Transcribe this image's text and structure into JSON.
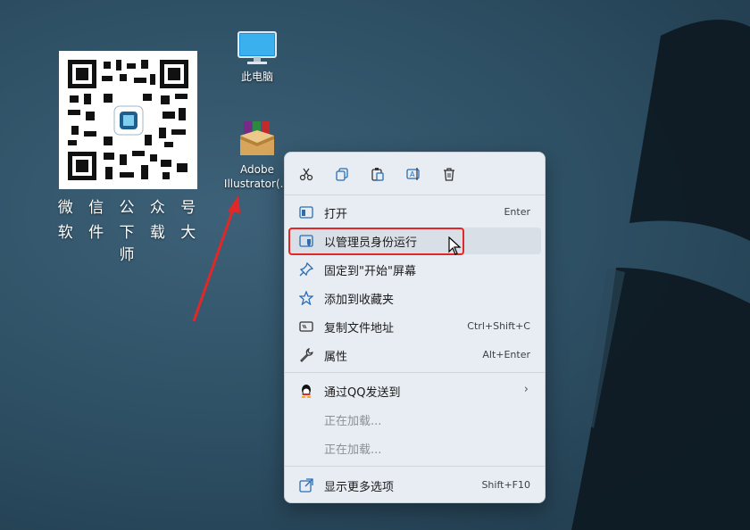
{
  "qr": {
    "line1": "微 信 公 众 号",
    "line2": "软 件 下 载 大 师"
  },
  "desktop": {
    "pc_label": "此电脑",
    "ai_label_1": "Adobe",
    "ai_label_2": "Illustrator(..."
  },
  "menu": {
    "toolbar": [
      "cut-icon",
      "copy-icon",
      "paste-icon",
      "rename-icon",
      "delete-icon"
    ],
    "items": [
      {
        "label": "打开",
        "shortcut": "Enter"
      },
      {
        "label": "以管理员身份运行",
        "shortcut": ""
      },
      {
        "label": "固定到\"开始\"屏幕",
        "shortcut": ""
      },
      {
        "label": "添加到收藏夹",
        "shortcut": ""
      },
      {
        "label": "复制文件地址",
        "shortcut": "Ctrl+Shift+C"
      },
      {
        "label": "属性",
        "shortcut": "Alt+Enter"
      },
      {
        "label": "通过QQ发送到",
        "shortcut": ""
      },
      {
        "label": "正在加载...",
        "shortcut": ""
      },
      {
        "label": "正在加载...",
        "shortcut": ""
      },
      {
        "label": "显示更多选项",
        "shortcut": "Shift+F10"
      }
    ],
    "highlight_color": "#e02828"
  }
}
